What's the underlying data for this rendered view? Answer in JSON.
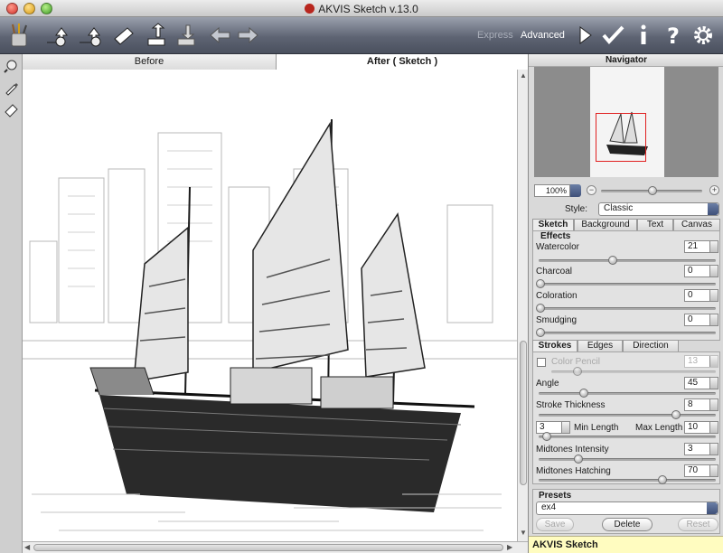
{
  "window": {
    "title": "AKVIS Sketch v.13.0"
  },
  "toolbar": {
    "icons": [
      "open-image-icon",
      "open-batch-icon",
      "clean-icon",
      "upload-icon",
      "download-icon",
      "undo-icon",
      "redo-icon",
      "run-icon",
      "apply-icon",
      "info-icon",
      "help-icon",
      "settings-icon"
    ],
    "modes": {
      "express": "Express",
      "advanced": "Advanced"
    }
  },
  "left_tools": [
    "hand-zoom-icon",
    "brush-icon",
    "eraser-icon"
  ],
  "view_tabs": {
    "before": "Before",
    "after": "After ( Sketch )"
  },
  "navigator": {
    "title": "Navigator",
    "zoom": "100%"
  },
  "settings": {
    "style_label": "Style:",
    "style_value": "Classic",
    "tabs": [
      "Sketch",
      "Background",
      "Text",
      "Canvas"
    ],
    "effects": {
      "title": "Effects",
      "watercolor": {
        "label": "Watercolor",
        "value": "21",
        "level": 0.21
      },
      "charcoal": {
        "label": "Charcoal",
        "value": "0",
        "level": 0
      },
      "coloration": {
        "label": "Coloration",
        "value": "0",
        "level": 0
      },
      "smudging": {
        "label": "Smudging",
        "value": "0",
        "level": 0
      }
    },
    "stroke_tabs": [
      "Strokes",
      "Edges",
      "Direction"
    ],
    "strokes": {
      "color_pencil": {
        "label": "Color Pencil",
        "value": "13",
        "level": 0.13
      },
      "angle": {
        "label": "Angle",
        "value": "45",
        "level": 0.25
      },
      "stroke_thickness": {
        "label": "Stroke Thickness",
        "value": "8",
        "level": 0.8
      },
      "min_length": {
        "label": "Min Length",
        "value": "3"
      },
      "max_length": {
        "label": "Max Length",
        "value": "10"
      },
      "midtones_intensity": {
        "label": "Midtones Intensity",
        "value": "3",
        "level": 0.3
      },
      "midtones_hatching": {
        "label": "Midtones Hatching",
        "value": "70",
        "level": 0.7
      }
    }
  },
  "presets": {
    "title": "Presets",
    "value": "ex4",
    "save": "Save",
    "delete": "Delete",
    "reset": "Reset"
  },
  "footer": {
    "label": "AKVIS Sketch"
  }
}
